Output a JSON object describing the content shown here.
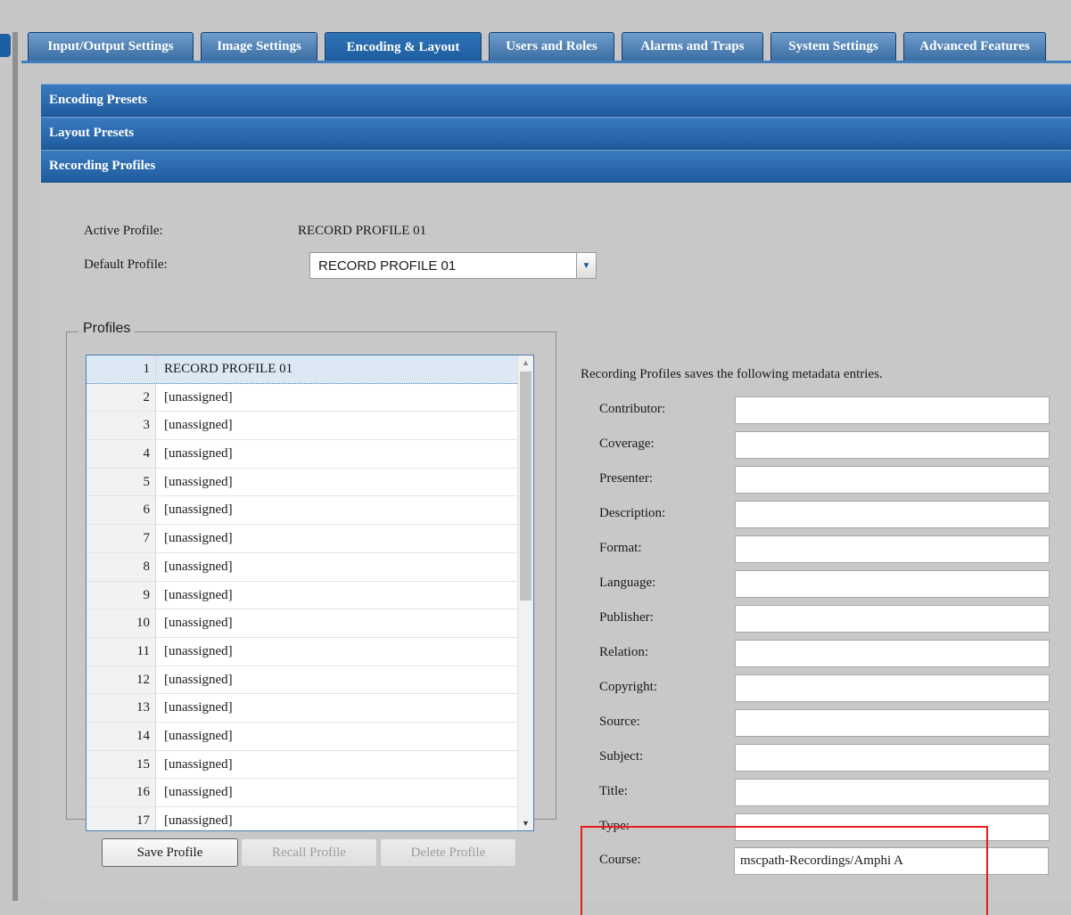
{
  "tabs": [
    {
      "label": "Input/Output Settings",
      "active": false
    },
    {
      "label": "Image Settings",
      "active": false
    },
    {
      "label": "Encoding & Layout",
      "active": true
    },
    {
      "label": "Users and Roles",
      "active": false
    },
    {
      "label": "Alarms and Traps",
      "active": false
    },
    {
      "label": "System Settings",
      "active": false
    },
    {
      "label": "Advanced Features",
      "active": false
    }
  ],
  "sections": {
    "encoding_presets": "Encoding Presets",
    "layout_presets": "Layout Presets",
    "recording_profiles": "Recording Profiles"
  },
  "recording": {
    "active_profile_label": "Active Profile:",
    "active_profile_value": "RECORD PROFILE 01",
    "default_profile_label": "Default Profile:",
    "default_profile_value": "RECORD PROFILE 01"
  },
  "profiles": {
    "legend": "Profiles",
    "selected_index": 1,
    "items": [
      {
        "num": "1",
        "name": "RECORD PROFILE 01"
      },
      {
        "num": "2",
        "name": "[unassigned]"
      },
      {
        "num": "3",
        "name": "[unassigned]"
      },
      {
        "num": "4",
        "name": "[unassigned]"
      },
      {
        "num": "5",
        "name": "[unassigned]"
      },
      {
        "num": "6",
        "name": "[unassigned]"
      },
      {
        "num": "7",
        "name": "[unassigned]"
      },
      {
        "num": "8",
        "name": "[unassigned]"
      },
      {
        "num": "9",
        "name": "[unassigned]"
      },
      {
        "num": "10",
        "name": "[unassigned]"
      },
      {
        "num": "11",
        "name": "[unassigned]"
      },
      {
        "num": "12",
        "name": "[unassigned]"
      },
      {
        "num": "13",
        "name": "[unassigned]"
      },
      {
        "num": "14",
        "name": "[unassigned]"
      },
      {
        "num": "15",
        "name": "[unassigned]"
      },
      {
        "num": "16",
        "name": "[unassigned]"
      },
      {
        "num": "17",
        "name": "[unassigned]"
      }
    ],
    "buttons": {
      "save": "Save Profile",
      "recall": "Recall Profile",
      "delete": "Delete Profile"
    }
  },
  "metadata": {
    "intro": "Recording Profiles saves the following metadata entries.",
    "fields": [
      {
        "label": "Contributor:",
        "value": ""
      },
      {
        "label": "Coverage:",
        "value": ""
      },
      {
        "label": "Presenter:",
        "value": ""
      },
      {
        "label": "Description:",
        "value": ""
      },
      {
        "label": "Format:",
        "value": ""
      },
      {
        "label": "Language:",
        "value": ""
      },
      {
        "label": "Publisher:",
        "value": ""
      },
      {
        "label": "Relation:",
        "value": ""
      },
      {
        "label": "Copyright:",
        "value": ""
      },
      {
        "label": "Source:",
        "value": ""
      },
      {
        "label": "Subject:",
        "value": ""
      },
      {
        "label": "Title:",
        "value": ""
      },
      {
        "label": "Type:",
        "value": ""
      },
      {
        "label": "Course:",
        "value": "mscpath-Recordings/Amphi A"
      }
    ]
  },
  "colors": {
    "accent_blue": "#1f5c9e",
    "highlight_red": "#e81a1a"
  }
}
